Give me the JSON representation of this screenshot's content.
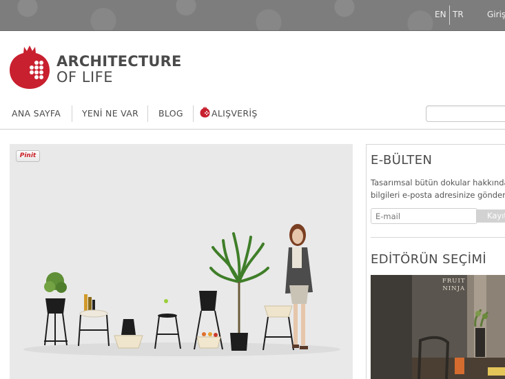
{
  "topbar": {
    "lang_en": "EN",
    "lang_tr": "TR",
    "login_label": "Giriş"
  },
  "logo": {
    "line1": "ARCHITECTURE",
    "line2": "OF LIFE",
    "icon": "pomegranate-icon",
    "brand_color": "#c8202f"
  },
  "nav": {
    "items": [
      {
        "label": "ANA SAYFA"
      },
      {
        "label": "YENİ NE VAR"
      },
      {
        "label": "BLOG"
      },
      {
        "label": "ALIŞVERİŞ",
        "icon": "pomegranate-icon"
      }
    ],
    "search_placeholder": ""
  },
  "hero": {
    "pin_label": "Pinit"
  },
  "sidebar": {
    "ebulten": {
      "title": "E-BÜLTEN",
      "desc_line1": "Tasarımsal bütün dokular hakkında",
      "desc_line2": "bilgileri e-posta adresinize gönder",
      "email_placeholder": "E-mail",
      "button_label": "Kayıt"
    },
    "editor": {
      "title": "EDİTÖRÜN SEÇİMİ",
      "image_caption_line1": "FRUIT",
      "image_caption_line2": "NINJA"
    }
  }
}
